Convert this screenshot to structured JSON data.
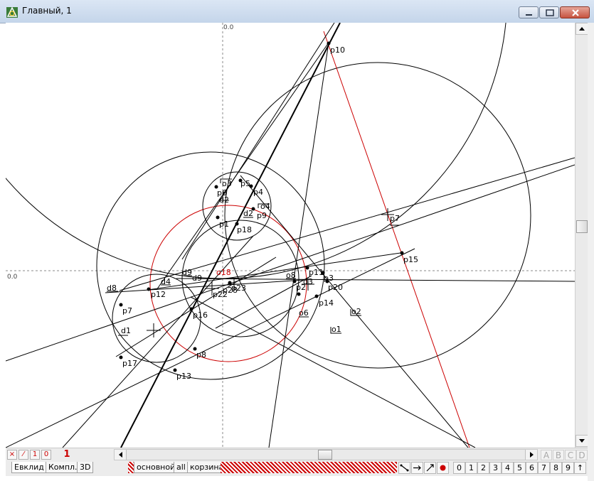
{
  "window": {
    "title": "Главный, 1",
    "icon": "app-geometry-icon"
  },
  "canvas": {
    "axis_top_label": "0.0",
    "axis_left_label": "0.0",
    "labels": {
      "p10": "p10",
      "p5": "p5",
      "p6": "p6",
      "p4": "p4",
      "p3": "p3",
      "d2a": "d2",
      "d2b": "d2",
      "d3": "d3",
      "o3": "o3",
      "o4": "o4",
      "p9a": "p9",
      "p1": "p1",
      "p18": "p18",
      "p15": "p15",
      "p7_right": "p7",
      "d9a": "d9",
      "d9b": "d9",
      "d4": "d4",
      "d8": "d8",
      "p12": "p12",
      "o18": "o18",
      "p22": "p22",
      "p28": "p28",
      "p23": "p23",
      "o8": "o8",
      "p11": "p11",
      "p2": "p2",
      "o6": "o6",
      "p20": "p20",
      "p14": "p14",
      "o2": "o2",
      "o1": "o1",
      "p7": "p7",
      "p16": "p16",
      "d1": "d1",
      "p8": "p8",
      "p17": "p17",
      "p13": "p13"
    }
  },
  "statusbar": {
    "mode_buttons": [
      "×",
      "⁄",
      "1",
      "0"
    ],
    "current_value": "1",
    "layer_letters": [
      "A",
      "B",
      "C",
      "D"
    ]
  },
  "tabs": {
    "left": [
      "Евклид",
      "Компл.",
      "3D"
    ],
    "layers": [
      "основной",
      "all",
      "корзина"
    ]
  },
  "toolbar": {
    "tools": [
      "segment-tool-icon",
      "arrow-right-icon",
      "scale-arrow-icon",
      "record-dot-icon"
    ],
    "digits": [
      "0",
      "1",
      "2",
      "3",
      "4",
      "5",
      "6",
      "7",
      "8",
      "9",
      "↑"
    ]
  },
  "colors": {
    "accent_red": "#cc0000",
    "line_black": "#000000"
  }
}
